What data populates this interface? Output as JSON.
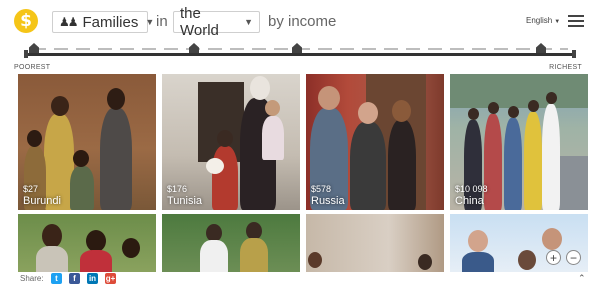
{
  "header": {
    "logo_symbol": "$",
    "selector_families": "Families",
    "in_text": "in",
    "selector_place": "the World",
    "by_income_text": "by income",
    "language": "English"
  },
  "income_strip": {
    "poorest_label": "POOREST",
    "richest_label": "RICHEST"
  },
  "families": [
    {
      "price": "$27",
      "country": "Burundi"
    },
    {
      "price": "$176",
      "country": "Tunisia"
    },
    {
      "price": "$578",
      "country": "Russia"
    },
    {
      "price": "$10 098",
      "country": "China"
    }
  ],
  "footer": {
    "share_label": "Share:",
    "zoom_in": "+",
    "zoom_out": "−"
  },
  "colors": {
    "logo": "#f5c518",
    "twitter": "#1da1f2",
    "facebook": "#3b5998",
    "linkedin": "#0077b5",
    "googleplus": "#dd4b39"
  }
}
